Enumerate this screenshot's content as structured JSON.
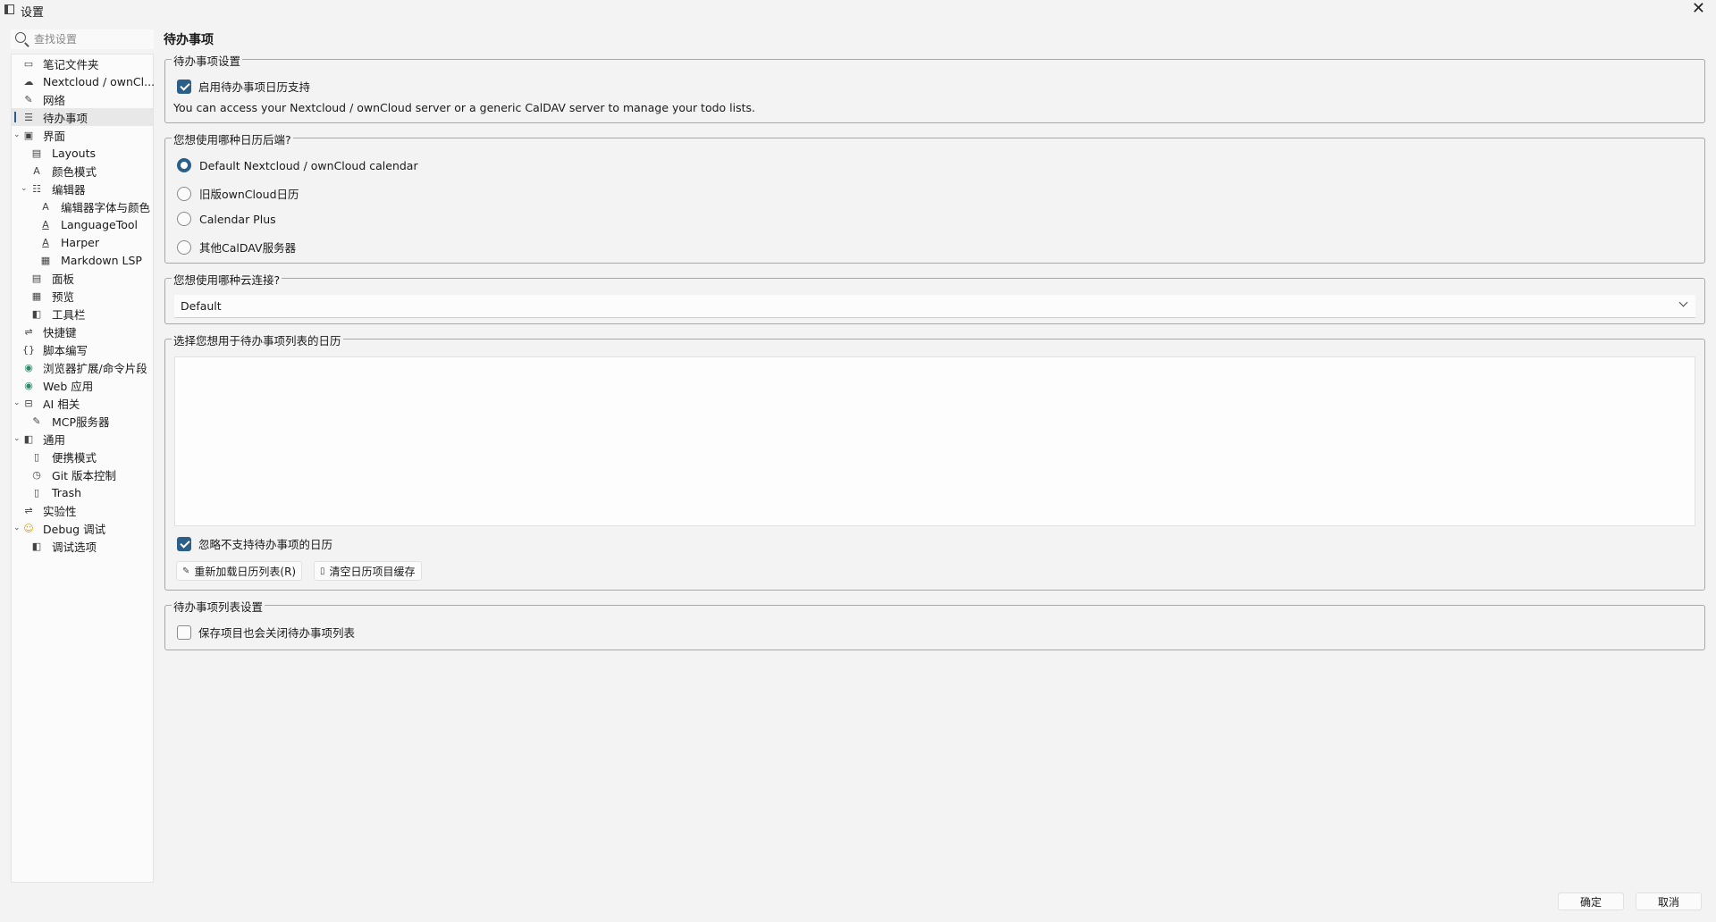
{
  "window": {
    "title": "设置"
  },
  "search": {
    "placeholder": "查找设置"
  },
  "sidebar": {
    "items": [
      {
        "label": "笔记文件夹",
        "icon": "folder-icon"
      },
      {
        "label": "Nextcloud / ownCl...",
        "icon": "cloud-icon"
      },
      {
        "label": "网络",
        "icon": "network-icon"
      },
      {
        "label": "待办事项",
        "icon": "todo-list-icon",
        "selected": true
      },
      {
        "label": "界面",
        "icon": "interface-icon",
        "expanded": true
      },
      {
        "label": "Layouts",
        "icon": "layout-icon"
      },
      {
        "label": "颜色模式",
        "icon": "color-mode-icon"
      },
      {
        "label": "编辑器",
        "icon": "editor-icon",
        "expanded": true
      },
      {
        "label": "编辑器字体与颜色",
        "icon": "font-color-icon"
      },
      {
        "label": "LanguageTool",
        "icon": "spellcheck-icon"
      },
      {
        "label": "Harper",
        "icon": "spellcheck-icon"
      },
      {
        "label": "Markdown LSP",
        "icon": "markdown-lsp-icon"
      },
      {
        "label": "面板",
        "icon": "panel-icon"
      },
      {
        "label": "预览",
        "icon": "preview-icon"
      },
      {
        "label": "工具栏",
        "icon": "toolbar-icon"
      },
      {
        "label": "快捷键",
        "icon": "shortcut-icon"
      },
      {
        "label": "脚本编写",
        "icon": "script-icon"
      },
      {
        "label": "浏览器扩展/命令片段",
        "icon": "browser-extension-icon"
      },
      {
        "label": "Web 应用",
        "icon": "web-app-icon"
      },
      {
        "label": "AI 相关",
        "icon": "ai-icon",
        "expanded": true
      },
      {
        "label": "MCP服务器",
        "icon": "mcp-server-icon"
      },
      {
        "label": "通用",
        "icon": "general-icon",
        "expanded": true
      },
      {
        "label": "便携模式",
        "icon": "portable-icon"
      },
      {
        "label": "Git 版本控制",
        "icon": "git-icon"
      },
      {
        "label": "Trash",
        "icon": "trash-icon"
      },
      {
        "label": "实验性",
        "icon": "experimental-icon"
      },
      {
        "label": "Debug 调试",
        "icon": "debug-icon",
        "expanded": true
      },
      {
        "label": "调试选项",
        "icon": "debug-options-icon"
      }
    ]
  },
  "main": {
    "page_title": "待办事项",
    "todo_settings": {
      "legend": "待办事项设置",
      "enable_label": "启用待办事项日历支持",
      "enable_checked": true,
      "description": "You can access your Nextcloud / ownCloud server or a generic CalDAV server to manage your todo lists."
    },
    "backend": {
      "legend": "您想使用哪种日历后端?",
      "options": [
        {
          "label": "Default Nextcloud / ownCloud calendar",
          "checked": true
        },
        {
          "label": "旧版ownCloud日历",
          "checked": false
        },
        {
          "label": "Calendar Plus",
          "checked": false
        },
        {
          "label": "其他CalDAV服务器",
          "checked": false
        }
      ]
    },
    "cloud_connection": {
      "legend": "您想使用哪种云连接?",
      "selected": "Default"
    },
    "calendar_select": {
      "legend": "选择您想用于待办事项列表的日历",
      "ignore_label": "忽略不支持待办事项的日历",
      "ignore_checked": true,
      "reload_button": "重新加载日历列表(R)",
      "clear_cache_button": "清空日历项目缓存"
    },
    "list_settings": {
      "legend": "待办事项列表设置",
      "close_label": "保存项目也会关闭待办事项列表",
      "close_checked": false
    }
  },
  "footer": {
    "ok": "确定",
    "cancel": "取消"
  },
  "colors": {
    "accent": "#2b5f8a",
    "background": "#f3f3f3"
  }
}
